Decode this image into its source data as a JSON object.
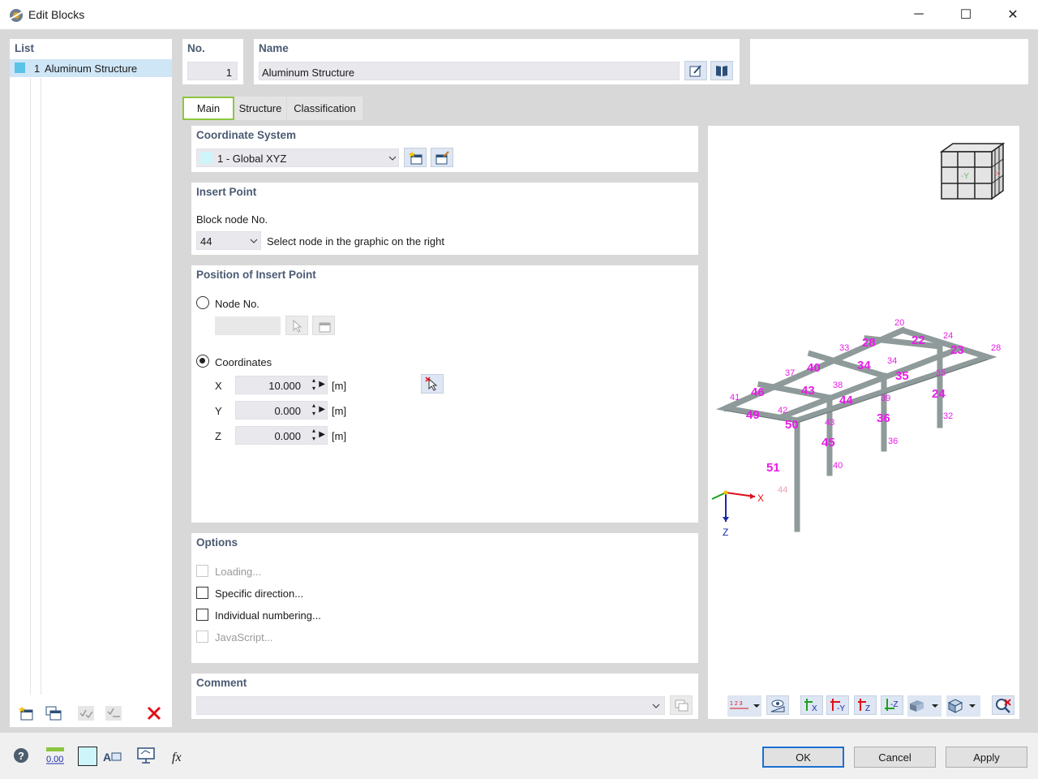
{
  "window": {
    "title": "Edit Blocks",
    "minimize": "─",
    "maximize": "☐",
    "close": "✕"
  },
  "list": {
    "header": "List",
    "items": [
      {
        "no": "1",
        "label": "Aluminum Structure",
        "color": "#5bc3e6"
      }
    ]
  },
  "no": {
    "label": "No.",
    "value": "1"
  },
  "name": {
    "label": "Name",
    "value": "Aluminum Structure"
  },
  "tabs": [
    {
      "label": "Main",
      "active": true
    },
    {
      "label": "Structure",
      "active": false
    },
    {
      "label": "Classification",
      "active": false
    }
  ],
  "coordinate_system": {
    "header": "Coordinate System",
    "selected": "1 - Global XYZ"
  },
  "insert_point": {
    "header": "Insert Point",
    "node_label": "Block node No.",
    "node_value": "44",
    "hint": "Select node in the graphic on the right"
  },
  "position": {
    "header": "Position of Insert Point",
    "node_option": "Node No.",
    "coord_option": "Coordinates",
    "selected_option": "Coordinates",
    "x": {
      "label": "X",
      "value": "10.000",
      "unit": "[m]"
    },
    "y": {
      "label": "Y",
      "value": "0.000",
      "unit": "[m]"
    },
    "z": {
      "label": "Z",
      "value": "0.000",
      "unit": "[m]"
    }
  },
  "options": {
    "header": "Options",
    "items": [
      {
        "label": "Loading...",
        "enabled": false,
        "checked": false
      },
      {
        "label": "Specific direction...",
        "enabled": true,
        "checked": false
      },
      {
        "label": "Individual numbering...",
        "enabled": true,
        "checked": false
      },
      {
        "label": "JavaScript...",
        "enabled": false,
        "checked": false
      }
    ]
  },
  "comment": {
    "header": "Comment",
    "value": ""
  },
  "graphic": {
    "axis_x": "X",
    "axis_z": "Z",
    "cube_labels": {
      "front": "-Y",
      "right": "X"
    },
    "member_labels": [
      "20",
      "28",
      "22",
      "24",
      "23",
      "28",
      "33",
      "34",
      "34",
      "35",
      "37",
      "40",
      "38",
      "43",
      "44",
      "39",
      "35",
      "24",
      "41",
      "46",
      "42",
      "49",
      "50",
      "43",
      "36",
      "45",
      "36",
      "51",
      "40",
      "44",
      "32"
    ],
    "colors": {
      "label": "#e81ce8",
      "member": "#8f9a9a"
    }
  },
  "buttons": {
    "ok": "OK",
    "cancel": "Cancel",
    "apply": "Apply"
  },
  "footer": {
    "decimal_badge": "0.00"
  }
}
